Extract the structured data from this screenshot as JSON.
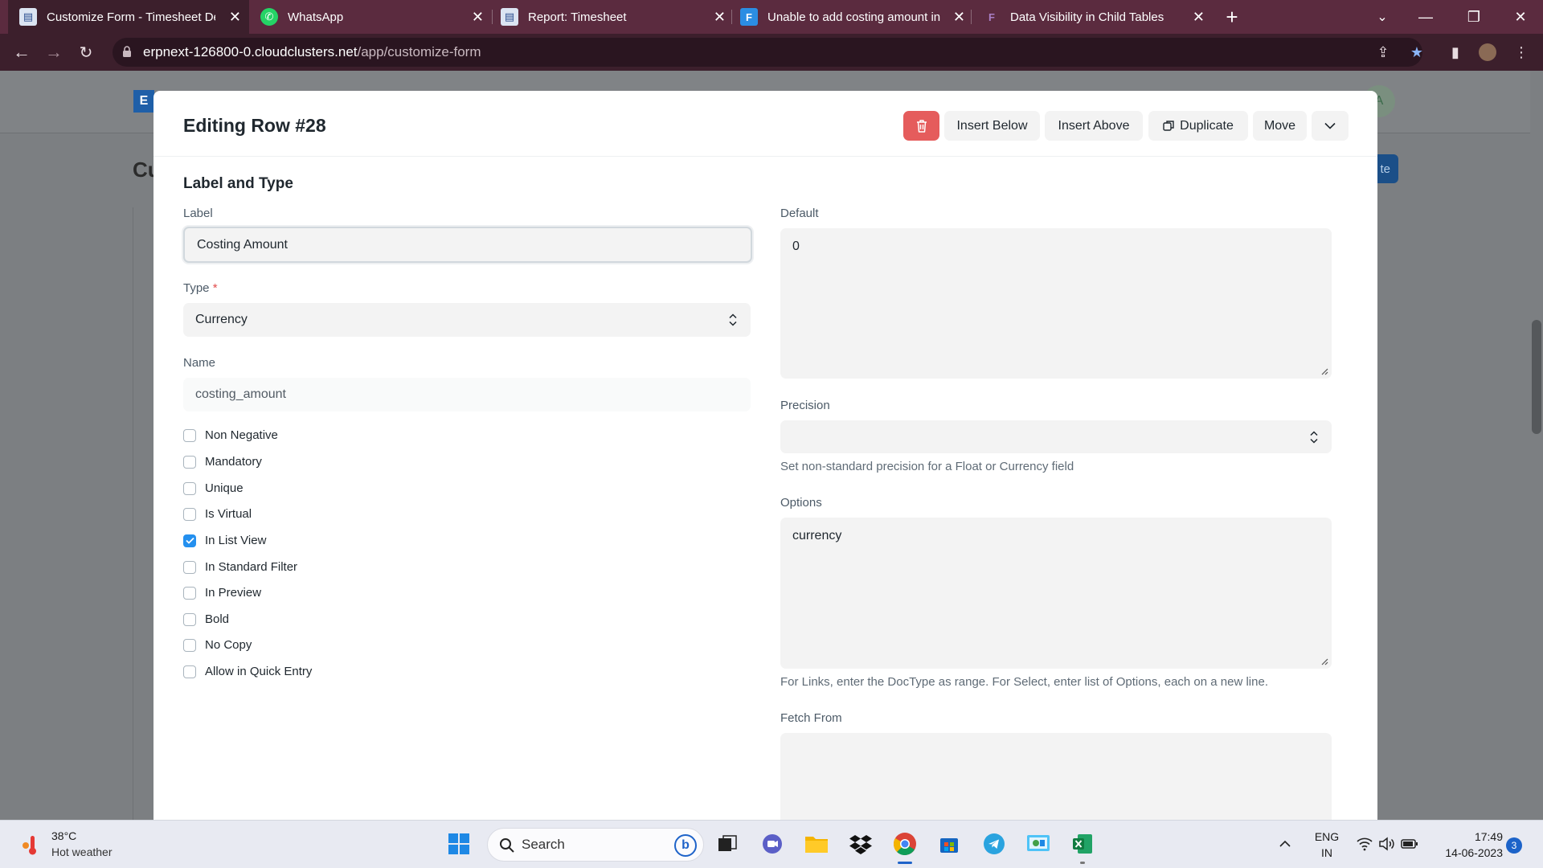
{
  "browser": {
    "tabs": [
      {
        "title": "Customize Form - Timesheet Det",
        "icon": "form-page-icon",
        "active": true
      },
      {
        "title": "WhatsApp",
        "icon": "whatsapp-icon",
        "active": false
      },
      {
        "title": "Report: Timesheet",
        "icon": "report-page-icon",
        "active": false
      },
      {
        "title": "Unable to add costing amount in",
        "icon": "frappe-forum-icon",
        "active": false
      },
      {
        "title": "Data Visibility in Child Tables",
        "icon": "frappe-icon",
        "active": false
      }
    ],
    "url_host": "erpnext-126800-0.cloudclusters.net",
    "url_path": "/app/customize-form"
  },
  "background_app": {
    "logo_letter": "E",
    "page_title": "Cu",
    "avatar_letter": "A",
    "primary_action": "te"
  },
  "modal": {
    "title": "Editing Row #28",
    "actions": {
      "insert_below": "Insert Below",
      "insert_above": "Insert Above",
      "duplicate": "Duplicate",
      "move": "Move"
    },
    "section_title": "Label and Type",
    "fields": {
      "label": {
        "label": "Label",
        "value": "Costing Amount"
      },
      "type": {
        "label": "Type",
        "required_mark": "*",
        "value": "Currency"
      },
      "name": {
        "label": "Name",
        "value": "costing_amount"
      },
      "default": {
        "label": "Default",
        "value": "0"
      },
      "precision": {
        "label": "Precision",
        "value": "",
        "help": "Set non-standard precision for a Float or Currency field"
      },
      "options": {
        "label": "Options",
        "value": "currency",
        "help": "For Links, enter the DocType as range. For Select, enter list of Options, each on a new line."
      },
      "fetch_from": {
        "label": "Fetch From",
        "value": ""
      }
    },
    "checkboxes": [
      {
        "label": "Non Negative",
        "checked": false
      },
      {
        "label": "Mandatory",
        "checked": false
      },
      {
        "label": "Unique",
        "checked": false
      },
      {
        "label": "Is Virtual",
        "checked": false
      },
      {
        "label": "In List View",
        "checked": true
      },
      {
        "label": "In Standard Filter",
        "checked": false
      },
      {
        "label": "In Preview",
        "checked": false
      },
      {
        "label": "Bold",
        "checked": false
      },
      {
        "label": "No Copy",
        "checked": false
      },
      {
        "label": "Allow in Quick Entry",
        "checked": false
      }
    ]
  },
  "taskbar": {
    "weather_temp": "38°C",
    "weather_desc": "Hot weather",
    "search_label": "Search",
    "lang_top": "ENG",
    "lang_bottom": "IN",
    "time": "17:49",
    "date": "14-06-2023",
    "notification_count": "3"
  },
  "colors": {
    "accent": "#2490ef",
    "delete": "#e55c5c",
    "browser_frame": "#5b2b3f"
  }
}
